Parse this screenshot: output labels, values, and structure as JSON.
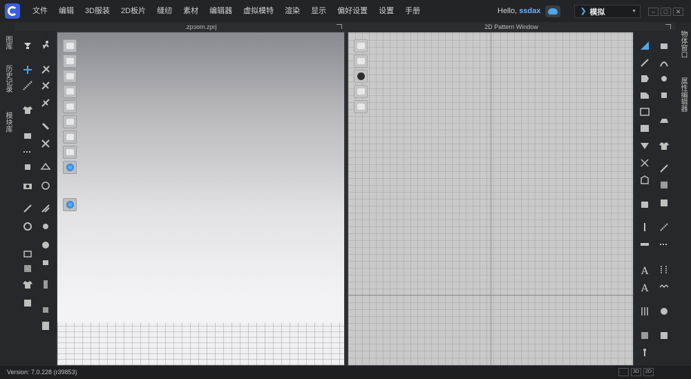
{
  "menu": [
    "文件",
    "编辑",
    "3D服装",
    "2D板片",
    "缝纫",
    "素材",
    "编辑器",
    "虚拟模特",
    "渲染",
    "显示",
    "偏好设置",
    "设置",
    "手册"
  ],
  "user": {
    "greeting": "Hello,",
    "name": "ssdax"
  },
  "mode": {
    "label": "模拟"
  },
  "left_tabs": [
    "图库",
    "历史记录",
    "模块库"
  ],
  "right_tabs": [
    "物体窗口",
    "属性编辑器"
  ],
  "window_3d": {
    "title": ".zpɔom.zprj"
  },
  "window_2d": {
    "title": "2D Pattern Window"
  },
  "status": {
    "version": "Version: 7.0.228 (r39853)"
  },
  "view_buttons": [
    "",
    "3D",
    "2D"
  ],
  "colors": {
    "accent": "#3c5de0",
    "username": "#6fb0ff",
    "cloud": "#4fa6e8"
  }
}
